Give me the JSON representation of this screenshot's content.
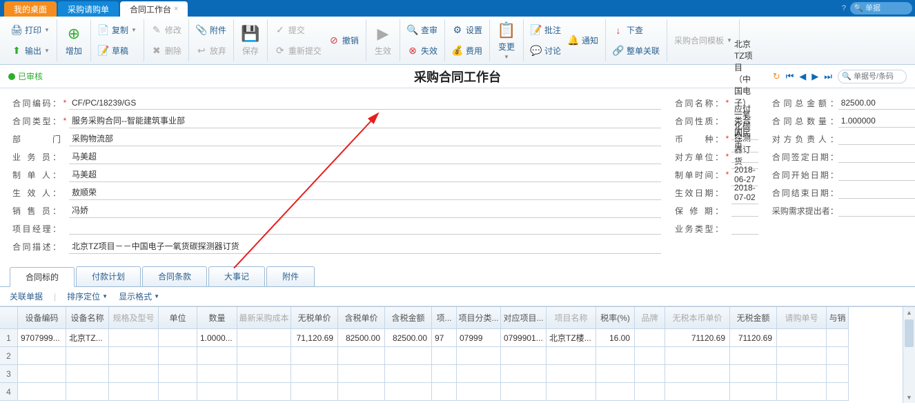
{
  "top_tabs": {
    "desktop": "我的桌面",
    "purchase_req": "采购请购单",
    "contract_wb": "合同工作台"
  },
  "top_search_placeholder": "单据",
  "toolbar": {
    "print": "打印",
    "output": "输出",
    "add": "增加",
    "copy": "复制",
    "draft": "草稿",
    "edit": "修改",
    "delete": "删除",
    "attach": "附件",
    "abandon": "放弃",
    "save": "保存",
    "submit": "提交",
    "resubmit": "重新提交",
    "revoke": "撤销",
    "effect": "生效",
    "review": "查审",
    "invalid": "失效",
    "setting": "设置",
    "cost": "费用",
    "change": "变更",
    "remark_approve": "批注",
    "discuss": "讨论",
    "notify": "通知",
    "down_check": "下查",
    "whole_close": "整单关联",
    "contract_template": "采购合同模板"
  },
  "status": "已审核",
  "page_title": "采购合同工作台",
  "nav_search_placeholder": "单据号/条码",
  "form": {
    "col1": {
      "contract_no_label": "合同编码：",
      "contract_no": "CF/PC/18239/GS",
      "contract_type_label": "合同类型：",
      "contract_type": "服务采购合同--智能建筑事业部",
      "dept_label": "部　　门",
      "dept": "采购物流部",
      "biz_person_label": "业 务 员：",
      "biz_person": "马美超",
      "maker_label": "制 单 人：",
      "maker": "马美超",
      "effector_label": "生 效 人：",
      "effector": "敖顺荣",
      "seller_label": "销 售 员：",
      "seller": "冯娇",
      "pm_label": "项目经理：",
      "pm": "",
      "desc_label": "合同描述：",
      "desc": "北京TZ项目－－中国电子一氧货碳探测器订货"
    },
    "col2": {
      "contract_name_label": "合同名称：",
      "contract_name": "北京TZ项目（中国电子）  一氧化碳探测器订货",
      "contract_nature_label": "合同性质：",
      "contract_nature": "应付类合同",
      "currency_label": "币　　种：",
      "currency": "人民币",
      "counterparty_label": "对方单位：",
      "counterparty": "",
      "make_time_label": "制单时间：",
      "make_time": "2018-06-27",
      "effect_date_label": "生效日期：",
      "effect_date": "2018-07-02",
      "warranty_label": "保 修 期：",
      "warranty": "",
      "biz_type_label": "业务类型：",
      "biz_type": ""
    },
    "col3": {
      "total_amount_label": "合同总金额：",
      "total_amount": "82500.00",
      "total_qty_label": "合同总数量：",
      "total_qty": "1.000000",
      "counter_owner_label": "对方负责人：",
      "counter_owner": "",
      "sign_date_label": "合同签定日期：",
      "sign_date": "",
      "start_date_label": "合同开始日期：",
      "start_date": "",
      "end_date_label": "合同结束日期：",
      "end_date": "",
      "demand_owner_label": "采购需求提出者：",
      "demand_owner": ""
    }
  },
  "sub_tabs": {
    "target": "合同标的",
    "pay_plan": "付款计划",
    "terms": "合同条款",
    "events": "大事记",
    "attach": "附件"
  },
  "grid_tools": {
    "relate_doc": "关联单据",
    "sort_locate": "排序定位",
    "display_fmt": "显示格式"
  },
  "grid": {
    "headers": {
      "equip_no": "设备编码",
      "equip_name": "设备名称",
      "spec": "规格及型号",
      "unit": "单位",
      "qty": "数量",
      "latest_cost": "最新采购成本",
      "price_notax": "无税单价",
      "price_tax": "含税单价",
      "amount_tax": "含税金额",
      "proj": "项...",
      "proj_cat": "项目分类...",
      "proj_match": "对应项目...",
      "proj_name": "项目名称",
      "tax_rate": "税率(%)",
      "brand": "品牌",
      "notax_local_price": "无税本币单价",
      "notax_amount": "无税金额",
      "req_no": "请购单号",
      "with_sale": "与销"
    },
    "rows": [
      {
        "equip_no": "9707999...",
        "equip_name": "北京TZ...",
        "spec": "",
        "unit": "",
        "qty": "1.0000...",
        "latest_cost": "",
        "price_notax": "71,120.69",
        "price_tax": "82500.00",
        "amount_tax": "82500.00",
        "proj": "97",
        "proj_cat": "07999",
        "proj_match": "0799901...",
        "proj_name": "北京TZ楼...",
        "tax_rate": "16.00",
        "brand": "",
        "notax_local_price": "71120.69",
        "notax_amount": "71120.69",
        "req_no": "",
        "with_sale": ""
      }
    ]
  }
}
